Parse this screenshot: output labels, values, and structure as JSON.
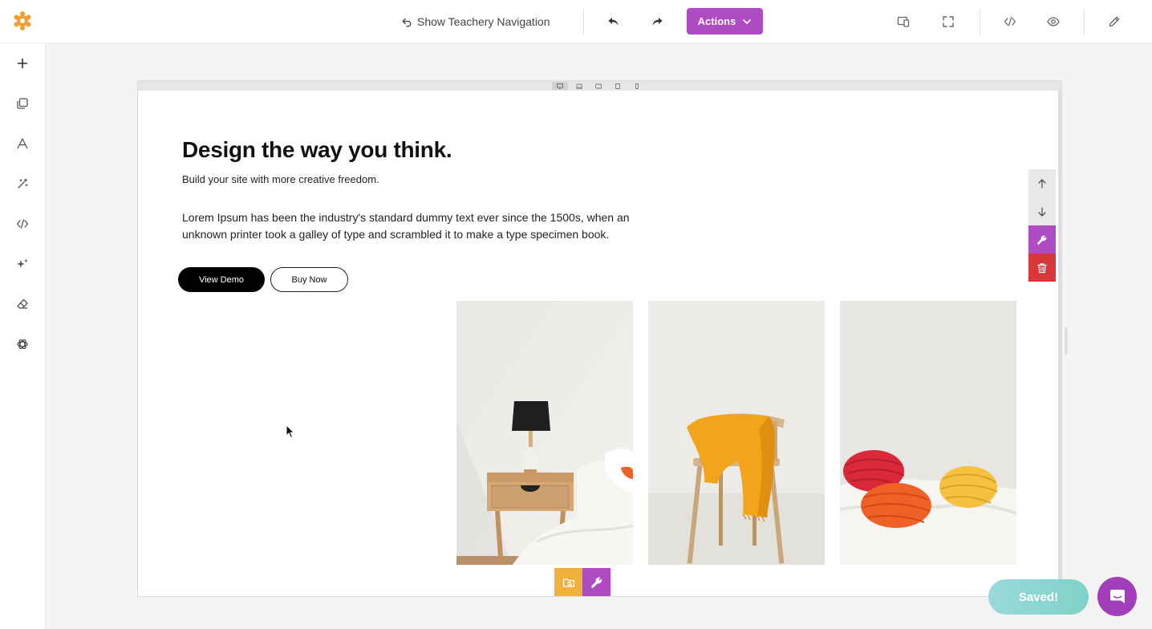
{
  "topbar": {
    "nav_toggle_label": "Show Teachery Navigation",
    "actions_label": "Actions",
    "icons": [
      "logo-icon",
      "undo-icon",
      "redo-icon",
      "chevron-down-icon",
      "responsive-preview-icon",
      "fullscreen-icon",
      "code-icon",
      "eye-icon",
      "pencil-icon"
    ]
  },
  "sidebar": {
    "items": [
      {
        "icon": "plus-icon"
      },
      {
        "icon": "layers-icon"
      },
      {
        "icon": "typography-icon"
      },
      {
        "icon": "magic-wand-icon"
      },
      {
        "icon": "code-icon"
      },
      {
        "icon": "sparkles-icon"
      },
      {
        "icon": "eraser-icon"
      },
      {
        "icon": "openai-icon"
      }
    ]
  },
  "device_preview": {
    "devices": [
      "desktop",
      "laptop",
      "tablet-landscape",
      "tablet-portrait",
      "mobile"
    ],
    "active": "desktop"
  },
  "hero": {
    "title": "Design the way you think.",
    "subtitle": "Build your site with more creative freedom.",
    "body": "Lorem Ipsum has been the industry's standard dummy text ever since the 1500s, when an unknown printer took a galley of type and scrambled it to make a type specimen book.",
    "primary_button": "View Demo",
    "secondary_button": "Buy Now"
  },
  "gallery": {
    "images": [
      "bedside-table-lamp-photo",
      "chair-with-yellow-throw-photo",
      "yarn-balls-photo"
    ]
  },
  "block_tools": [
    "move-up",
    "move-down",
    "edit-settings",
    "delete"
  ],
  "bottom_tools": [
    "media-library",
    "edit-settings"
  ],
  "status": {
    "saved_label": "Saved!"
  },
  "colors": {
    "accent": "#b04cc3",
    "delete": "#d9383a",
    "media": "#f0b13c",
    "saved_start": "#9ad8dc",
    "saved_end": "#7fd3c7",
    "chat": "#a03fb9"
  }
}
